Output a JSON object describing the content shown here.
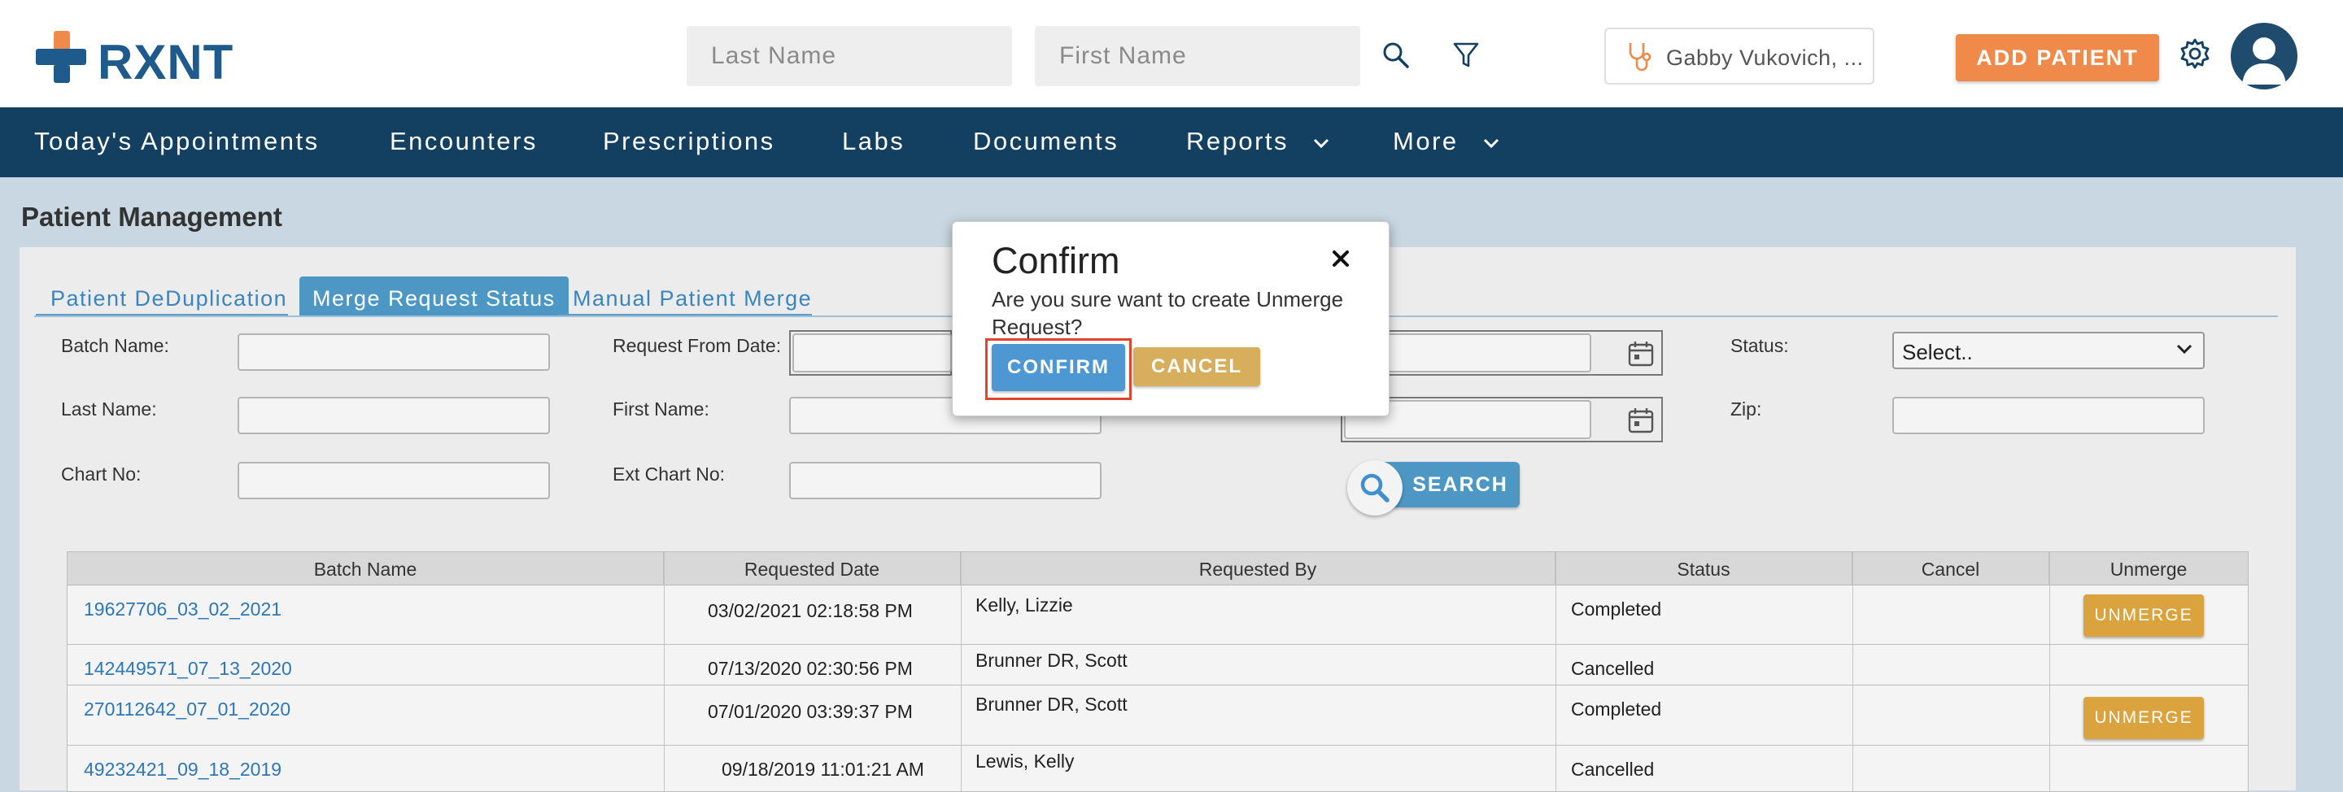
{
  "header": {
    "logo_text": "RXNT",
    "last_name_placeholder": "Last Name",
    "first_name_placeholder": "First Name",
    "provider_name": "Gabby Vukovich, ...",
    "add_patient_label": "ADD PATIENT"
  },
  "nav": {
    "items": [
      {
        "label": "Today's Appointments"
      },
      {
        "label": "Encounters"
      },
      {
        "label": "Prescriptions"
      },
      {
        "label": "Labs"
      },
      {
        "label": "Documents"
      },
      {
        "label": "Reports"
      },
      {
        "label": "More"
      }
    ]
  },
  "page": {
    "title": "Patient Management",
    "tabs": [
      {
        "label": "Patient DeDuplication"
      },
      {
        "label": "Merge Request Status",
        "active": true
      },
      {
        "label": "Manual Patient Merge"
      }
    ]
  },
  "filters": {
    "batch_name_label": "Batch Name:",
    "request_from_date_label": "Request From Date:",
    "status_label": "Status:",
    "status_value": "Select..",
    "last_name_label": "Last Name:",
    "first_name_label": "First Name:",
    "zip_label": "Zip:",
    "chart_no_label": "Chart No:",
    "ext_chart_no_label": "Ext Chart No:",
    "search_label": "SEARCH"
  },
  "grid": {
    "columns": [
      "Batch Name",
      "Requested Date",
      "Requested By",
      "Status",
      "Cancel",
      "Unmerge"
    ],
    "rows": [
      {
        "batch": "19627706_03_02_2021",
        "date": "03/02/2021 02:18:58 PM",
        "by": "Kelly, Lizzie",
        "status": "Completed",
        "unmerge": "UNMERGE"
      },
      {
        "batch": "142449571_07_13_2020",
        "date": "07/13/2020 02:30:56 PM",
        "by": "Brunner DR, Scott",
        "status": "Cancelled",
        "unmerge": ""
      },
      {
        "batch": "270112642_07_01_2020",
        "date": "07/01/2020 03:39:37 PM",
        "by": "Brunner DR, Scott",
        "status": "Completed",
        "unmerge": "UNMERGE"
      },
      {
        "batch": "49232421_09_18_2019",
        "date": "09/18/2019 11:01:21 AM",
        "by": "Lewis, Kelly",
        "status": "Cancelled",
        "unmerge": ""
      }
    ]
  },
  "dialog": {
    "title": "Confirm",
    "message": "Are you sure want to create Unmerge Request?",
    "confirm_label": "CONFIRM",
    "cancel_label": "CANCEL"
  },
  "colors": {
    "brand_blue": "#1e5a8c",
    "brand_orange": "#ef8a4a",
    "nav_bg": "#133f61",
    "accent_blue": "#4d97c5",
    "unmerge_gold": "#dba33e",
    "highlight_red": "#e2432c"
  },
  "icons": [
    "rxnt-logo-icon",
    "search-icon",
    "filter-icon",
    "stethoscope-icon",
    "gear-icon",
    "user-avatar-icon",
    "chevron-down-icon",
    "calendar-icon",
    "close-icon"
  ]
}
